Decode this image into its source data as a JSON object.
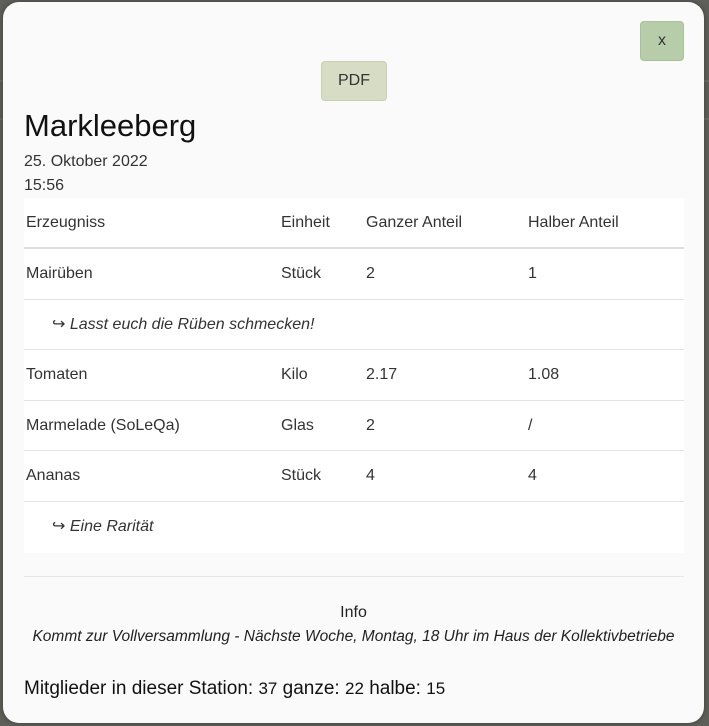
{
  "modal": {
    "close_label": "x",
    "pdf_label": "PDF",
    "station_name": "Markleeberg",
    "date": "25. Oktober 2022",
    "time": "15:56"
  },
  "table": {
    "headers": [
      "Erzeugniss",
      "Einheit",
      "Ganzer Anteil",
      "Halber Anteil"
    ],
    "rows": [
      {
        "product": "Mairüben",
        "unit": "Stück",
        "full": "2",
        "half": "1",
        "note": "↪ Lasst euch die Rüben schmecken!"
      },
      {
        "product": "Tomaten",
        "unit": "Kilo",
        "full": "2.17",
        "half": "1.08"
      },
      {
        "product": "Marmelade (SoLeQa)",
        "unit": "Glas",
        "full": "2",
        "half": "/"
      },
      {
        "product": "Ananas",
        "unit": "Stück",
        "full": "4",
        "half": "4",
        "note": "↪ Eine Rarität"
      }
    ]
  },
  "info": {
    "title": "Info",
    "text": "Kommt zur Vollversammlung - Nächste Woche, Montag, 18 Uhr im Haus der Kollektivbetriebe"
  },
  "members": {
    "label": "Mitglieder in dieser Station:",
    "count": "37",
    "full_label": "ganze:",
    "full_count": "22",
    "half_label": "halbe:",
    "half_count": "15"
  },
  "colors": {
    "close_button": "#b7cdaa",
    "pdf_button": "#d7dcc4",
    "modal_bg": "#fafafa"
  }
}
